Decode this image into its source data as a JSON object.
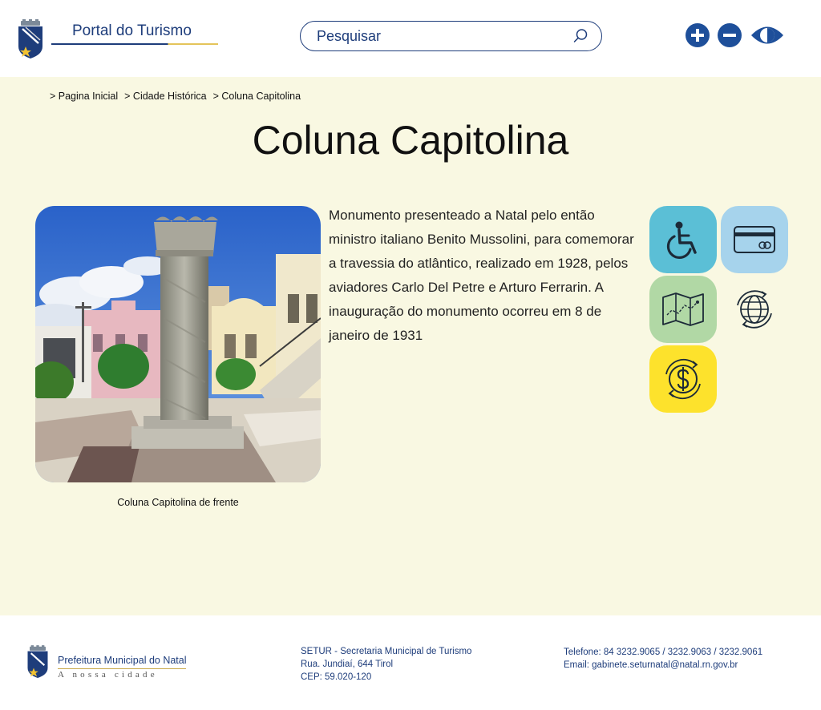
{
  "header": {
    "logo_text": "Portal do Turismo",
    "search_placeholder": "Pesquisar"
  },
  "icons": {
    "crest": "city-crest-icon",
    "search": "search-icon",
    "zoom_in": "plus-circle-icon",
    "zoom_out": "minus-circle-icon",
    "contrast": "eye-contrast-icon"
  },
  "breadcrumb": [
    "> Pagina Inicial",
    "> Cidade Histórica",
    "> Coluna Capitolina"
  ],
  "page_title": "Coluna Capitolina",
  "photo_caption": "Coluna Capitolina de frente",
  "description": "Monumento presenteado a Natal pelo então ministro italiano Benito Mussolini, para comemorar a travessia do atlântico, realizado em 1928, pelos aviadores Carlo Del Petre e Arturo Ferrarin. A inauguração do monumento ocorreu em 8 de janeiro de 1931",
  "features": [
    {
      "icon": "wheelchair-icon",
      "color": "#5bbfd6"
    },
    {
      "icon": "credit-card-icon",
      "color": "#a6d3ec"
    },
    {
      "icon": "map-icon",
      "color": "#b1d8a5"
    },
    {
      "icon": "globe-icon",
      "color": "#f9f8e2"
    },
    {
      "icon": "money-exchange-icon",
      "color": "#fde22c"
    }
  ],
  "footer": {
    "logo_title": "Prefeitura Municipal do Natal",
    "logo_slogan": "A nossa cidade",
    "address": [
      "SETUR - Secretaria Municipal de Turismo",
      "Rua. Jundiaí, 644 Tirol",
      "CEP: 59.020-120"
    ],
    "contact": [
      "Telefone: 84 3232.9065 / 3232.9063 / 3232.9061",
      "Email: gabinete.seturnatal@natal.rn.gov.br"
    ]
  },
  "colors": {
    "brand_blue": "#1e3d7b",
    "page_background": "#f9f8e2",
    "accent_gold": "#e4c45a"
  }
}
